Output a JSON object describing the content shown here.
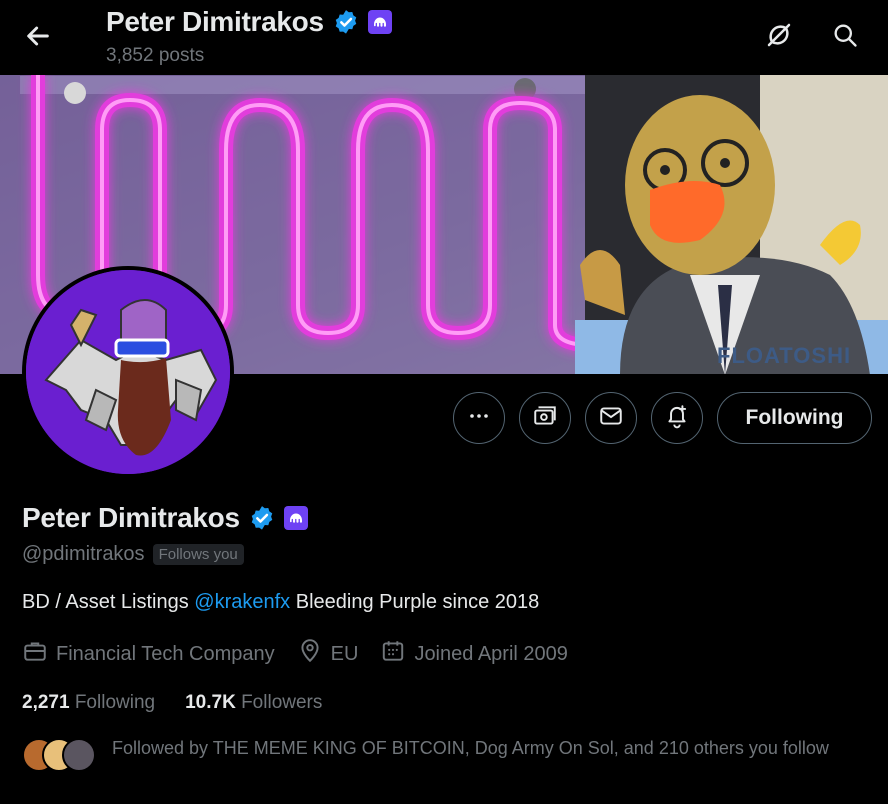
{
  "header": {
    "name": "Peter Dimitrakos",
    "posts": "3,852 posts"
  },
  "banner": {
    "box_label": "FLOATOSHI"
  },
  "profile": {
    "name": "Peter Dimitrakos",
    "handle": "@pdimitrakos",
    "follows_you": "Follows you",
    "bio_prefix": "BD / Asset Listings ",
    "bio_mention": "@krakenfx",
    "bio_suffix": " Bleeding Purple since 2018",
    "category": "Financial Tech Company",
    "location": "EU",
    "joined": "Joined April 2009"
  },
  "actions": {
    "following_label": "Following"
  },
  "stats": {
    "following_count": "2,271",
    "following_label": "Following",
    "followers_count": "10.7K",
    "followers_label": "Followers"
  },
  "followed_by": {
    "text": "Followed by THE MEME KING OF BITCOIN, Dog Army On Sol, and 210 others you follow"
  },
  "colors": {
    "accent": "#1d9bf0",
    "kraken": "#6e42f4",
    "muted": "#71767b"
  },
  "icons": [
    "back-arrow-icon",
    "verified-icon",
    "kraken-logo-icon",
    "grok-icon",
    "search-icon",
    "more-icon",
    "subscribe-icon",
    "message-icon",
    "notification-bell-icon",
    "briefcase-icon",
    "location-icon",
    "calendar-icon"
  ]
}
